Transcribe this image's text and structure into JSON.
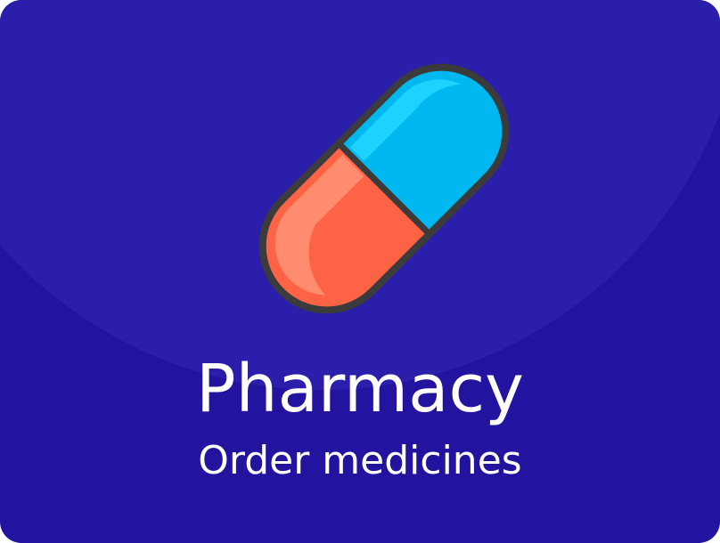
{
  "tile": {
    "title": "Pharmacy",
    "subtitle": "Order medicines",
    "icon": "pill-icon",
    "colors": {
      "background": "#2314a0",
      "background_glow": "#2b1eaa",
      "pill_blue": "#00c3f5",
      "pill_red": "#ff6346",
      "outline": "#3b3b3b",
      "text": "#ffffff"
    }
  }
}
